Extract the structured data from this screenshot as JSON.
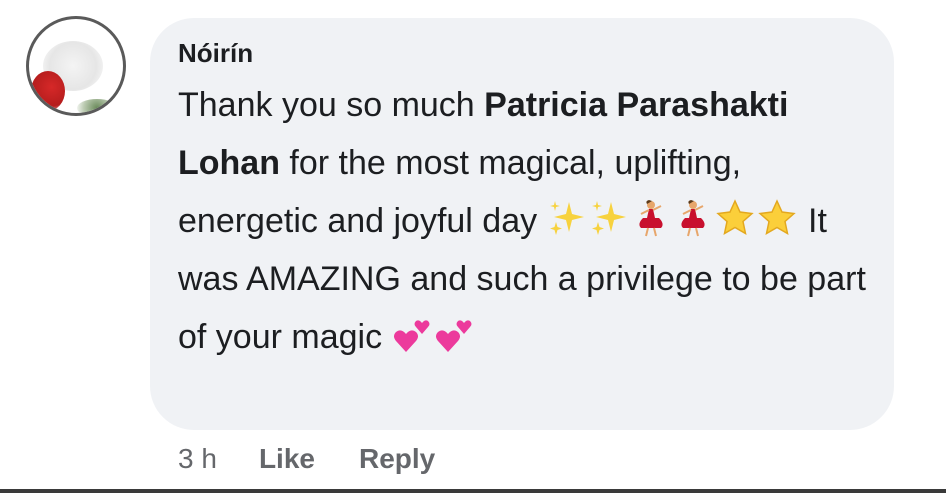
{
  "comment": {
    "author": "Nóirín",
    "body": {
      "text_1": "Thank you so much ",
      "mention": "Patricia Parashakti Lohan",
      "text_2": " for the most magical, uplifting, energetic and joyful day ",
      "emojis_1": [
        "sparkles-icon",
        "sparkles-icon",
        "dancer-icon",
        "dancer-icon",
        "star-icon",
        "star-icon"
      ],
      "text_3": " It was AMAZING and such a privilege to be part of your magic ",
      "emojis_2": [
        "two-hearts-icon",
        "two-hearts-icon"
      ]
    },
    "actions": {
      "time": "3 h",
      "like": "Like",
      "reply": "Reply"
    }
  },
  "colors": {
    "bubble": "#f0f2f5",
    "text": "#1c1e21",
    "secondary": "#65676b"
  }
}
